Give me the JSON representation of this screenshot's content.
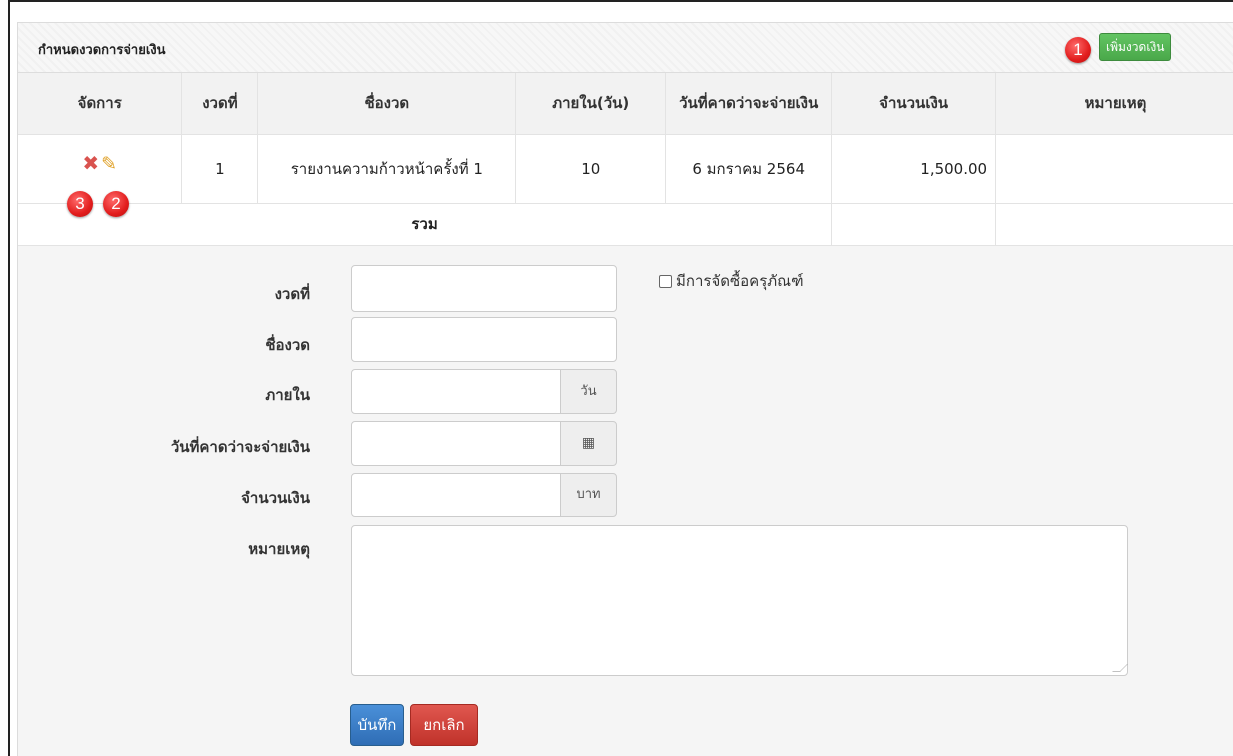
{
  "panel": {
    "title": "กำหนดงวดการจ่ายเงิน",
    "add_button": "เพิ่มงวดเงิน"
  },
  "badges": [
    "1",
    "2",
    "3"
  ],
  "table": {
    "headers": [
      "จัดการ",
      "งวดที่",
      "ชื่องวด",
      "ภายใน(วัน)",
      "วันที่คาดว่าจะจ่ายเงิน",
      "จำนวนเงิน",
      "หมายเหตุ"
    ],
    "rows": [
      {
        "no": "1",
        "name": "รายงานความก้าวหน้าครั้งที่ 1",
        "within": "10",
        "date": "6 มกราคม 2564",
        "amount": "1,500.00",
        "remark": ""
      }
    ],
    "total_label": "รวม"
  },
  "form": {
    "labels": {
      "no": "งวดที่",
      "name": "ชื่องวด",
      "within": "ภายใน",
      "date": "วันที่คาดว่าจะจ่ายเงิน",
      "amount": "จำนวนเงิน",
      "remark": "หมายเหตุ"
    },
    "addons": {
      "within": "วัน",
      "date_icon": "calendar-icon",
      "amount": "บาท"
    },
    "checkbox_label": "มีการจัดซื้อครุภัณฑ์",
    "checkbox_checked": false,
    "save_button": "บันทึก",
    "cancel_button": "ยกเลิก"
  },
  "colors": {
    "add_button": "#5cb85c",
    "save_button": "#337ab7",
    "cancel_button": "#d9534f",
    "badge": "#e21d1d",
    "total_label": "#9a1a1a"
  }
}
